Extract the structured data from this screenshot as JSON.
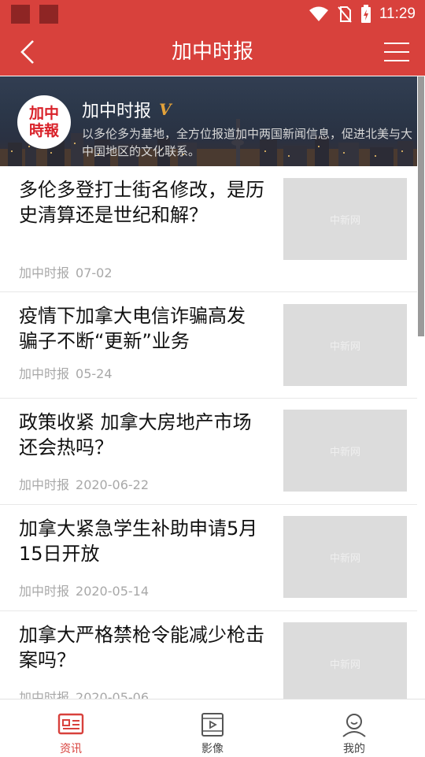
{
  "status_bar": {
    "time": "11:29"
  },
  "app_bar": {
    "title": "加中时报"
  },
  "banner": {
    "logo_text_line1": "加中",
    "logo_text_line2": "時報",
    "name": "加中时报",
    "verified_badge": "V",
    "description": "以多伦多为基地，全方位报道加中两国新闻信息，促进北美与大中国地区的文化联系。"
  },
  "feed": {
    "items": [
      {
        "headline": "多伦多登打士街名修改，是历史清算还是世纪和解？",
        "source": "加中时报",
        "date": "07-02",
        "thumb_watermark": "中新网"
      },
      {
        "headline": "疫情下加拿大电信诈骗高发 骗子不断“更新”业务",
        "source": "加中时报",
        "date": "05-24",
        "thumb_watermark": "中新网"
      },
      {
        "headline": "政策收紧  加拿大房地产市场还会热吗？",
        "source": "加中时报",
        "date": "2020-06-22",
        "thumb_watermark": "中新网"
      },
      {
        "headline": "加拿大紧急学生补助申请5月15日开放",
        "source": "加中时报",
        "date": "2020-05-14",
        "thumb_watermark": "中新网"
      },
      {
        "headline": "加拿大严格禁枪令能减少枪击案吗？",
        "source": "加中时报",
        "date": "2020-05-06",
        "thumb_watermark": "中新网"
      }
    ]
  },
  "tab_bar": {
    "tabs": [
      {
        "label": "资讯",
        "icon": "news-icon",
        "active": true
      },
      {
        "label": "影像",
        "icon": "video-icon",
        "active": false
      },
      {
        "label": "我的",
        "icon": "profile-icon",
        "active": false
      }
    ]
  },
  "colors": {
    "brand_red": "#d8413c",
    "status_dark_red": "#8e2524",
    "verified_gold": "#e3a23a"
  }
}
